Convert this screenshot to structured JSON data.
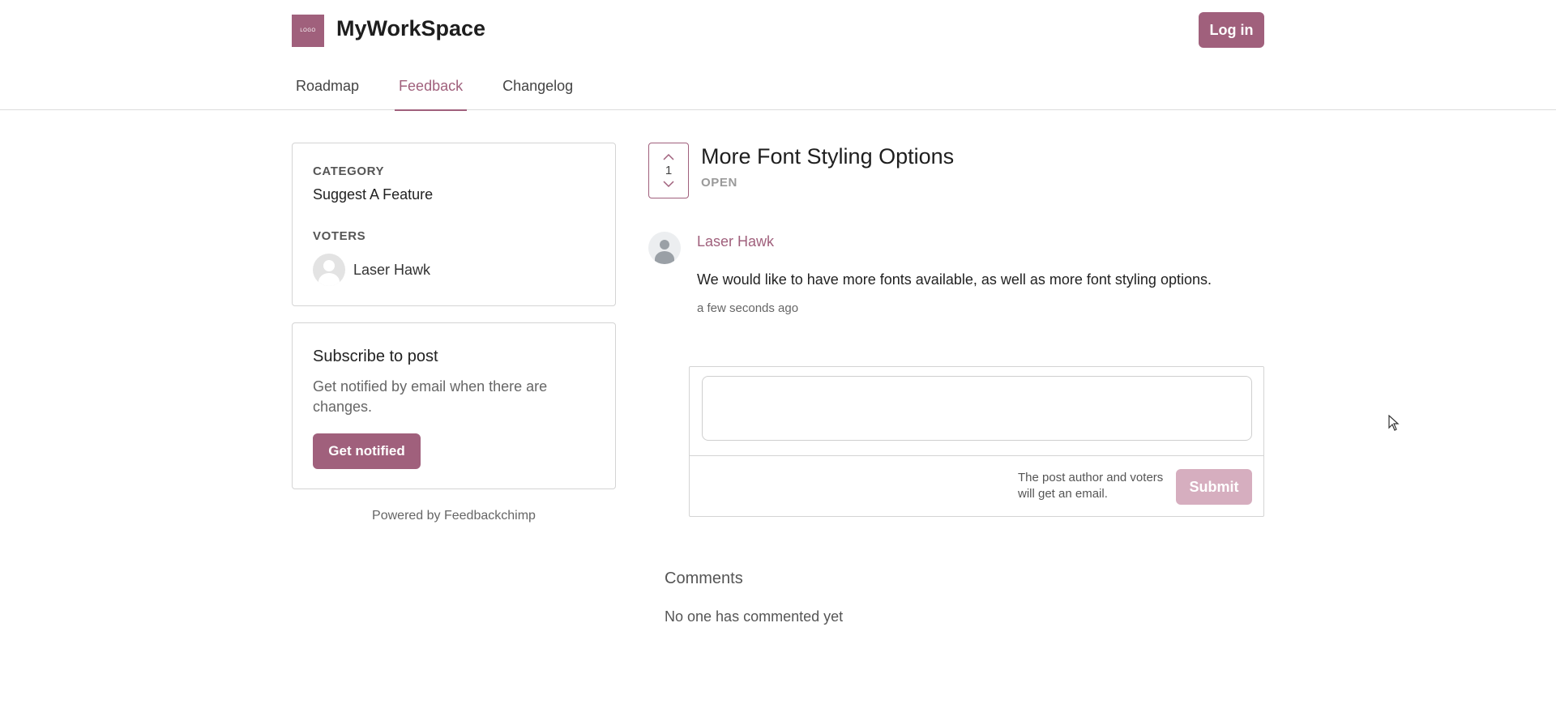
{
  "header": {
    "logo_text": "LOGO",
    "brand": "MyWorkSpace",
    "login_label": "Log in",
    "nav": [
      {
        "label": "Roadmap",
        "active": false
      },
      {
        "label": "Feedback",
        "active": true
      },
      {
        "label": "Changelog",
        "active": false
      }
    ]
  },
  "sidebar": {
    "category_label": "CATEGORY",
    "category_value": "Suggest A Feature",
    "voters_label": "VOTERS",
    "voters": [
      {
        "name": "Laser Hawk"
      }
    ],
    "subscribe": {
      "title": "Subscribe to post",
      "description": "Get notified by email when there are changes.",
      "button_label": "Get notified"
    },
    "powered_by": "Powered by Feedbackchimp"
  },
  "post": {
    "votes": "1",
    "title": "More Font Styling Options",
    "status": "OPEN",
    "author": "Laser Hawk",
    "body": "We would like to have more fonts available, as well as more font styling options.",
    "time": "a few seconds ago"
  },
  "comment_form": {
    "placeholder": "",
    "hint": "The post author and voters will get an email.",
    "submit_label": "Submit"
  },
  "comments": {
    "heading": "Comments",
    "empty_text": "No one has commented yet"
  },
  "colors": {
    "accent": "#a0607c",
    "accent_disabled": "#d6aebf",
    "border": "#d4d4d4"
  }
}
